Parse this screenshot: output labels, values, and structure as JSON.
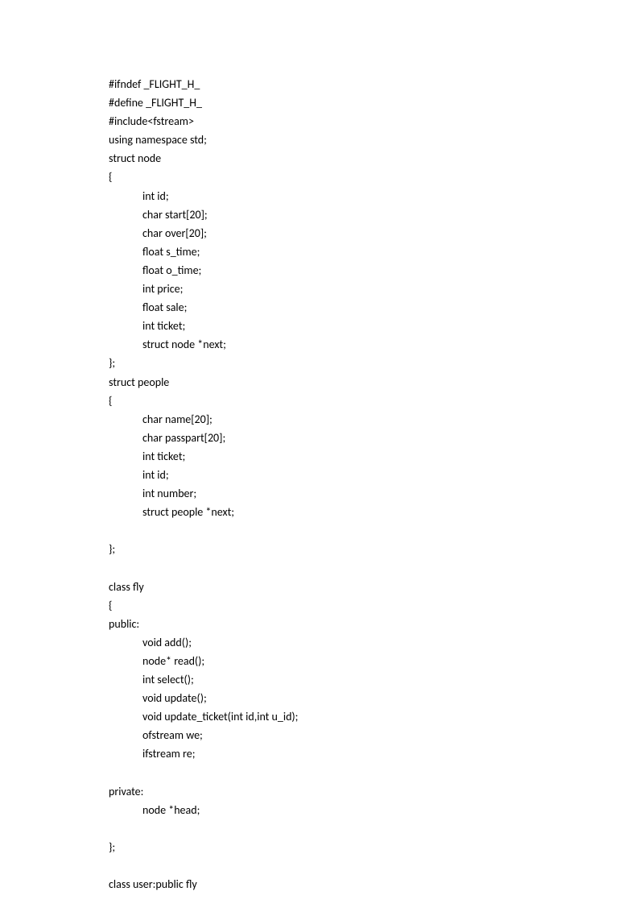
{
  "code": {
    "lines": [
      {
        "indent": 0,
        "text": "#ifndef _FLIGHT_H_"
      },
      {
        "indent": 0,
        "text": "#define _FLIGHT_H_"
      },
      {
        "indent": 0,
        "text": "#include<fstream>"
      },
      {
        "indent": 0,
        "text": "using namespace std;"
      },
      {
        "indent": 0,
        "text": "struct node"
      },
      {
        "indent": 0,
        "text": "{"
      },
      {
        "indent": 1,
        "text": "int id;"
      },
      {
        "indent": 1,
        "text": "char start[20];"
      },
      {
        "indent": 1,
        "text": "char over[20];"
      },
      {
        "indent": 1,
        "text": "float s_time;"
      },
      {
        "indent": 1,
        "text": "float o_time;"
      },
      {
        "indent": 1,
        "text": "int price;"
      },
      {
        "indent": 1,
        "text": "float sale;"
      },
      {
        "indent": 1,
        "text": "int ticket;"
      },
      {
        "indent": 1,
        "text": "struct node *next;"
      },
      {
        "indent": 0,
        "text": "};"
      },
      {
        "indent": 0,
        "text": "struct people"
      },
      {
        "indent": 0,
        "text": "{"
      },
      {
        "indent": 1,
        "text": "char name[20];"
      },
      {
        "indent": 1,
        "text": "char passpart[20];"
      },
      {
        "indent": 1,
        "text": "int ticket;"
      },
      {
        "indent": 1,
        "text": "int id;"
      },
      {
        "indent": 1,
        "text": "int number;"
      },
      {
        "indent": 1,
        "text": "struct people *next;"
      },
      {
        "indent": 0,
        "text": ""
      },
      {
        "indent": 0,
        "text": "};"
      },
      {
        "indent": 0,
        "text": ""
      },
      {
        "indent": 0,
        "text": "class fly"
      },
      {
        "indent": 0,
        "text": "{"
      },
      {
        "indent": 0,
        "text": "public:"
      },
      {
        "indent": 1,
        "text": "void add();"
      },
      {
        "indent": 1,
        "text": "node* read();"
      },
      {
        "indent": 1,
        "text": "int select();"
      },
      {
        "indent": 1,
        "text": "void update();"
      },
      {
        "indent": 1,
        "text": "void update_ticket(int id,int u_id);"
      },
      {
        "indent": 1,
        "text": "ofstream we;"
      },
      {
        "indent": 1,
        "text": "ifstream re;"
      },
      {
        "indent": 0,
        "text": ""
      },
      {
        "indent": 0,
        "text": "private:"
      },
      {
        "indent": 1,
        "text": "node *head;"
      },
      {
        "indent": 0,
        "text": ""
      },
      {
        "indent": 0,
        "text": "};"
      },
      {
        "indent": 0,
        "text": ""
      },
      {
        "indent": 0,
        "text": "class user:public fly"
      }
    ]
  }
}
